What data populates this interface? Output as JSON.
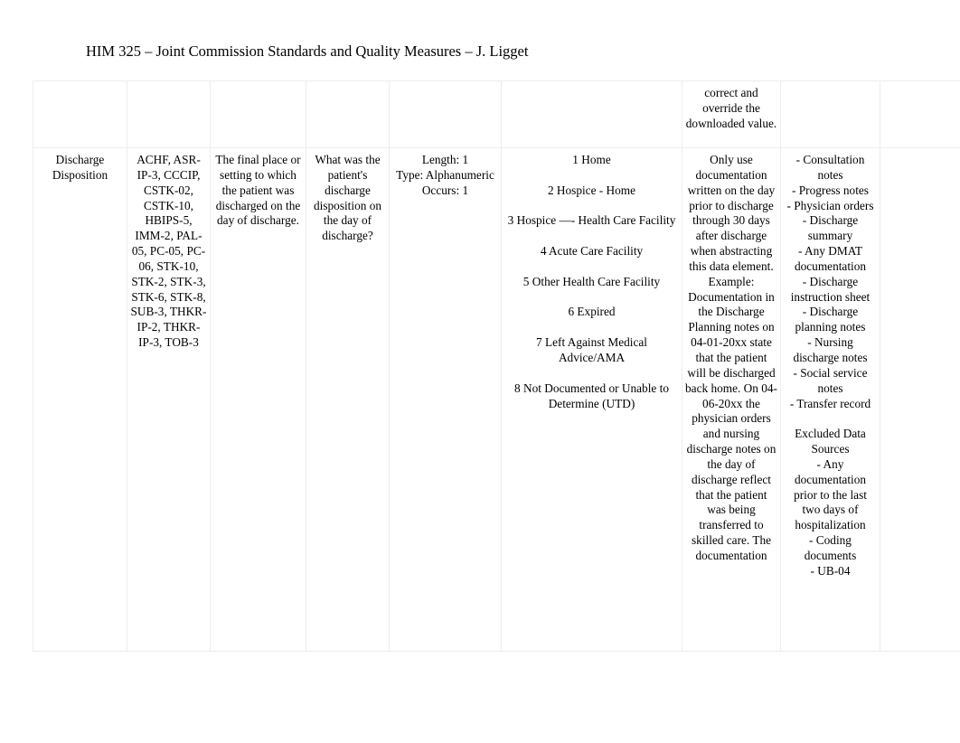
{
  "document": {
    "header": "HIM 325 – Joint Commission Standards and Quality Measures – J. Ligget"
  },
  "table": {
    "columns": [
      "data-element-name",
      "collected-for",
      "definition",
      "question",
      "format",
      "allowable-values",
      "notes-for-abstraction",
      "suggested-data-sources",
      "trailing"
    ],
    "rows": [
      {
        "name": "",
        "collected_for": "",
        "definition": "",
        "question": "",
        "format": "",
        "allowable_values": "",
        "notes": "correct and override the downloaded value.",
        "data_sources": "",
        "trailing": ""
      },
      {
        "name": "Discharge Disposition",
        "collected_for": "ACHF, ASR-IP-3, CCCIP, CSTK-02, CSTK-10, HBIPS-5, IMM-2, PAL-05, PC-05, PC-06, STK-10, STK-2, STK-3, STK-6, STK-8, SUB-3, THKR-IP-2, THKR-IP-3, TOB-3",
        "definition": "The final place or setting to which the patient was discharged on the day of discharge.",
        "question": "What was the patient's discharge disposition on the day of discharge?",
        "format": "Length: 1\nType: Alphanumeric\nOccurs: 1",
        "allowable_values": "1 Home\n\n2 Hospice - Home\n\n3 Hospice —- Health Care Facility\n\n4 Acute Care Facility\n\n5 Other Health Care Facility\n\n6 Expired\n\n7 Left Against Medical Advice/AMA\n\n8 Not Documented or Unable to Determine (UTD)",
        "notes": "Only use documentation written on the day prior to discharge through 30 days after discharge when abstracting this data element.\nExample: Documentation in the Discharge Planning notes on 04-01-20xx state that the patient will be discharged back home. On 04-06-20xx the physician orders and nursing discharge notes on the day of discharge reflect that the patient was being transferred to skilled care. The documentation",
        "data_sources": "- Consultation notes\n- Progress notes\n- Physician orders\n- Discharge summary\n- Any DMAT documentation\n- Discharge instruction sheet\n- Discharge planning notes\n- Nursing discharge notes\n- Social service notes\n- Transfer record\n\nExcluded Data Sources\n- Any documentation prior to the last two days of hospitalization\n- Coding documents\n- UB-04",
        "trailing": ""
      }
    ]
  },
  "colors": {
    "page_background": "#ffffff",
    "text": "#000000",
    "table_border": "#ededed"
  }
}
